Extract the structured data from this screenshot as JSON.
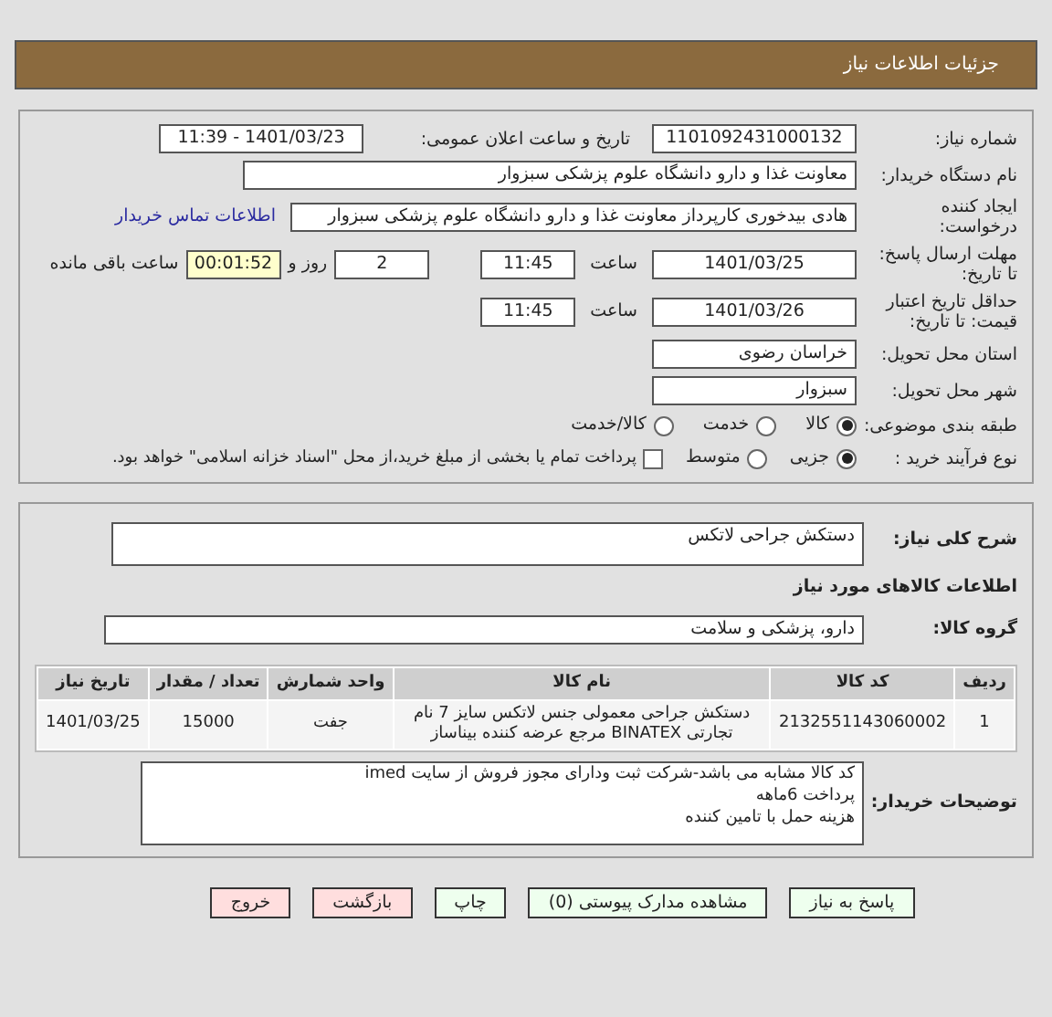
{
  "header": {
    "title": "جزئیات اطلاعات نیاز"
  },
  "need_number": {
    "label": "شماره نیاز:",
    "value": "1101092431000132"
  },
  "announce": {
    "label": "تاریخ و ساعت اعلان عمومی:",
    "value": "1401/03/23 - 11:39"
  },
  "buyer": {
    "label": "نام دستگاه خریدار:",
    "value": "معاونت غذا و دارو   دانشگاه علوم پزشکی سبزوار"
  },
  "creator": {
    "label": "ایجاد کننده درخواست:",
    "value": "هادی بیدخوری کارپرداز معاونت غذا و دارو   دانشگاه علوم پزشکی سبزوار",
    "link": "اطلاعات تماس خریدار"
  },
  "deadline": {
    "label": "مهلت ارسال پاسخ: تا تاریخ:",
    "date": "1401/03/25",
    "time_label": "ساعت",
    "time": "11:45",
    "days": "2",
    "days_label": "روز و",
    "remaining": "00:01:52",
    "remaining_label": "ساعت باقی مانده"
  },
  "validity": {
    "label": "حداقل تاریخ اعتبار قیمت: تا تاریخ:",
    "date": "1401/03/26",
    "time_label": "ساعت",
    "time": "11:45"
  },
  "province": {
    "label": "استان محل تحویل:",
    "value": "خراسان رضوی"
  },
  "city": {
    "label": "شهر محل تحویل:",
    "value": "سبزوار"
  },
  "category": {
    "label": "طبقه بندی موضوعی:",
    "options": [
      {
        "label": "کالا",
        "selected": true
      },
      {
        "label": "خدمت",
        "selected": false
      },
      {
        "label": "کالا/خدمت",
        "selected": false
      }
    ]
  },
  "process": {
    "label": "نوع فرآیند خرید :",
    "options": [
      {
        "label": "جزیی",
        "selected": true
      },
      {
        "label": "متوسط",
        "selected": false
      }
    ],
    "treasury": {
      "label": "پرداخت تمام یا بخشی از مبلغ خرید،از محل \"اسناد خزانه اسلامی\" خواهد بود.",
      "checked": false
    }
  },
  "description": {
    "label": "شرح کلی نیاز:",
    "value": "دستکش جراحی لاتکس"
  },
  "goods_heading": "اطلاعات کالاهای مورد نیاز",
  "goods_group": {
    "label": "گروه کالا:",
    "value": "دارو، پزشکی و سلامت"
  },
  "table": {
    "columns": [
      "ردیف",
      "کد کالا",
      "نام کالا",
      "واحد شمارش",
      "تعداد / مقدار",
      "تاریخ نیاز"
    ],
    "rows": [
      [
        "1",
        "2132551143060002",
        "دستکش جراحی معمولی جنس لاتکس سایز 7 نام تجارتی BINATEX مرجع عرضه کننده بیناساز",
        "جفت",
        "15000",
        "1401/03/25"
      ]
    ]
  },
  "notes": {
    "label": "توضیحات خریدار:",
    "lines": [
      "کد کالا مشابه می باشد-شرکت ثبت ودارای مجوز فروش از سایت imed",
      "پرداخت 6ماهه",
      "هزینه حمل با تامین کننده"
    ]
  },
  "buttons": [
    {
      "label": "پاسخ به نیاز",
      "color": "#eeffee"
    },
    {
      "label": "مشاهده مدارک پیوستی (0)",
      "color": "#eeffee"
    },
    {
      "label": "چاپ",
      "color": "#eeffee"
    },
    {
      "label": "بازگشت",
      "color": "#ffdede"
    },
    {
      "label": "خروج",
      "color": "#ffdede"
    }
  ]
}
